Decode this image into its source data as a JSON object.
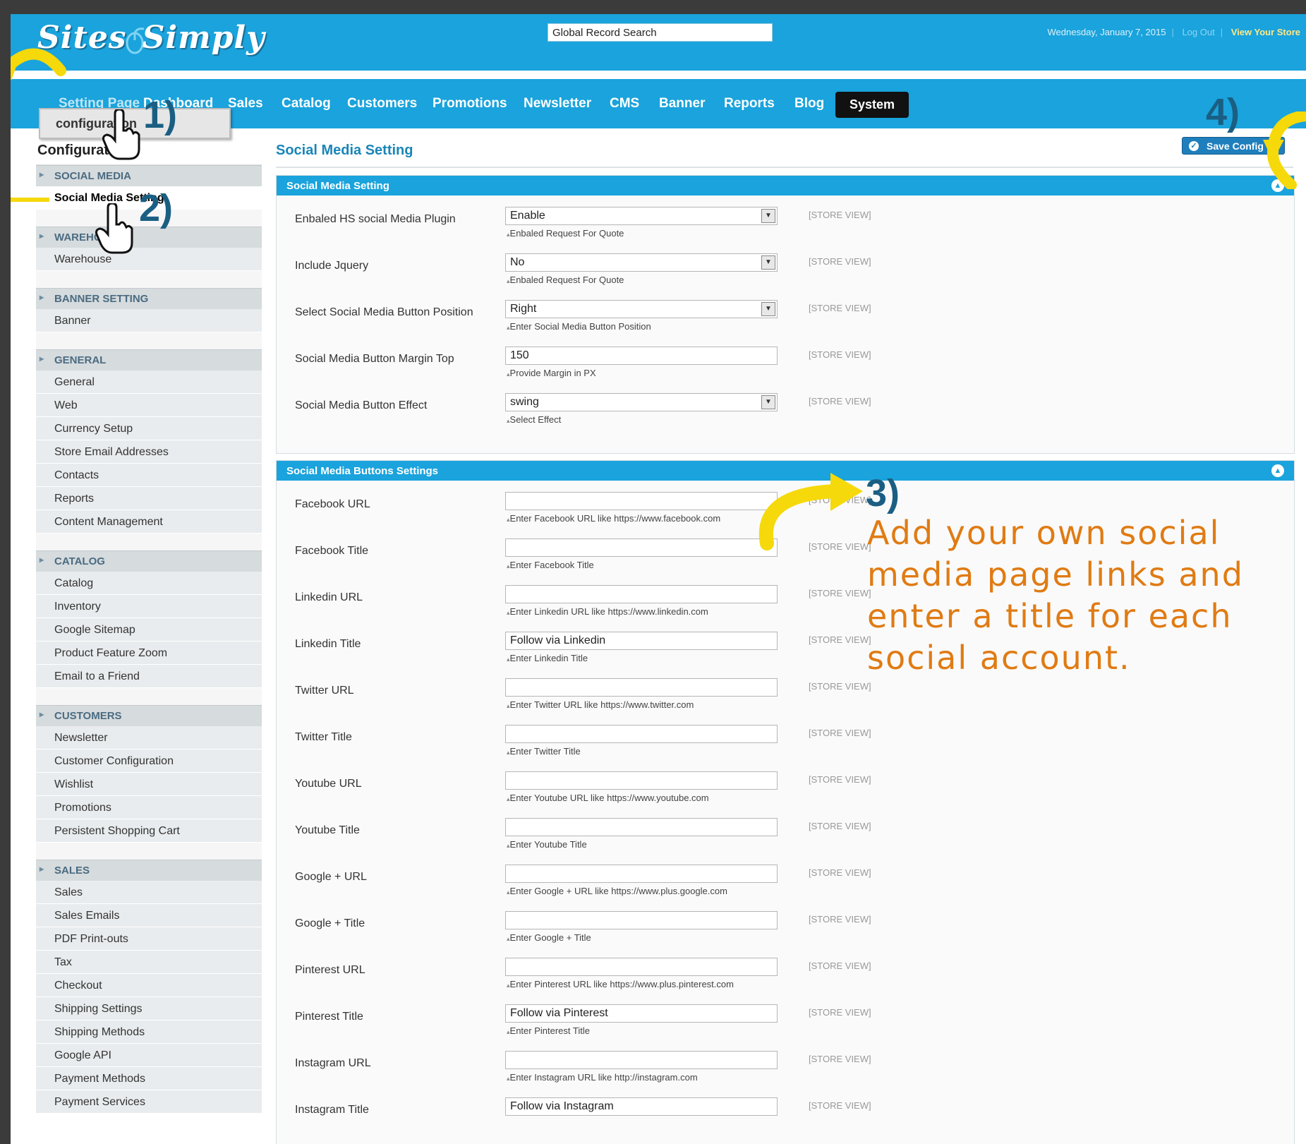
{
  "header": {
    "logo_text": "Sites Simply",
    "search_placeholder": "Global Record Search",
    "date": "Wednesday, January 7, 2015",
    "logout": "Log Out",
    "view_store": "View Your Store"
  },
  "nav": {
    "items": [
      "Setting Page",
      "Dashboard",
      "Sales",
      "Catalog",
      "Customers",
      "Promotions",
      "Newsletter",
      "CMS",
      "Banner",
      "Reports",
      "Blog",
      "System"
    ],
    "active": "System",
    "submenu_item": "configuration"
  },
  "sidebar": {
    "title": "Configuration",
    "groups": [
      {
        "head": "Social Media",
        "items": [
          "Social Media Setting"
        ]
      },
      {
        "head": "Warehouse",
        "items": [
          "Warehouse"
        ]
      },
      {
        "head": "Banner Setting",
        "items": [
          "Banner"
        ]
      },
      {
        "head": "General",
        "items": [
          "General",
          "Web",
          "Currency Setup",
          "Store Email Addresses",
          "Contacts",
          "Reports",
          "Content Management"
        ]
      },
      {
        "head": "Catalog",
        "items": [
          "Catalog",
          "Inventory",
          "Google Sitemap",
          "Product Feature Zoom",
          "Email to a Friend"
        ]
      },
      {
        "head": "Customers",
        "items": [
          "Newsletter",
          "Customer Configuration",
          "Wishlist",
          "Promotions",
          "Persistent Shopping Cart"
        ]
      },
      {
        "head": "Sales",
        "items": [
          "Sales",
          "Sales Emails",
          "PDF Print-outs",
          "Tax",
          "Checkout",
          "Shipping Settings",
          "Shipping Methods",
          "Google API",
          "Payment Methods",
          "Payment Services"
        ]
      }
    ]
  },
  "main": {
    "page_title": "Social Media Setting",
    "save_label": "Save Config",
    "scope_label": "[STORE VIEW]",
    "section1": {
      "title": "Social Media Setting",
      "rows": [
        {
          "label": "Enbaled HS social Media Plugin",
          "value": "Enable",
          "type": "select",
          "note": "Enbaled Request For Quote"
        },
        {
          "label": "Include Jquery",
          "value": "No",
          "type": "select",
          "note": "Enbaled Request For Quote"
        },
        {
          "label": "Select Social Media Button Position",
          "value": "Right",
          "type": "select",
          "note": "Enter Social Media Button Position"
        },
        {
          "label": "Social Media Button Margin Top",
          "value": "150",
          "type": "text",
          "note": "Provide Margin in PX"
        },
        {
          "label": "Social Media Button Effect",
          "value": "swing",
          "type": "select",
          "note": "Select Effect"
        }
      ]
    },
    "section2": {
      "title": "Social Media Buttons Settings",
      "rows": [
        {
          "label": "Facebook URL",
          "value": "",
          "type": "text",
          "note": "Enter Facebook URL like https://www.facebook.com"
        },
        {
          "label": "Facebook Title",
          "value": "",
          "type": "text",
          "note": "Enter Facebook Title"
        },
        {
          "label": "Linkedin URL",
          "value": "",
          "type": "text",
          "note": "Enter Linkedin URL like https://www.linkedin.com"
        },
        {
          "label": "Linkedin Title",
          "value": "Follow via Linkedin",
          "type": "text",
          "note": "Enter Linkedin Title"
        },
        {
          "label": "Twitter URL",
          "value": "",
          "type": "text",
          "note": "Enter Twitter URL like https://www.twitter.com"
        },
        {
          "label": "Twitter Title",
          "value": "",
          "type": "text",
          "note": "Enter Twitter Title"
        },
        {
          "label": "Youtube URL",
          "value": "",
          "type": "text",
          "note": "Enter Youtube URL like https://www.youtube.com"
        },
        {
          "label": "Youtube Title",
          "value": "",
          "type": "text",
          "note": "Enter Youtube Title"
        },
        {
          "label": "Google + URL",
          "value": "",
          "type": "text",
          "note": "Enter Google + URL like https://www.plus.google.com"
        },
        {
          "label": "Google + Title",
          "value": "",
          "type": "text",
          "note": "Enter Google + Title"
        },
        {
          "label": "Pinterest URL",
          "value": "",
          "type": "text",
          "note": "Enter Pinterest URL like https://www.plus.pinterest.com"
        },
        {
          "label": "Pinterest Title",
          "value": "Follow via Pinterest",
          "type": "text",
          "note": "Enter Pinterest Title"
        },
        {
          "label": "Instagram URL",
          "value": "",
          "type": "text",
          "note": "Enter Instagram URL like http://instagram.com"
        },
        {
          "label": "Instagram Title",
          "value": "Follow via Instagram",
          "type": "text",
          "note": ""
        }
      ]
    }
  },
  "annotations": {
    "step1": "1)",
    "step2": "2)",
    "step3": "3)",
    "step4": "4)",
    "step3_text": "Add your own social media page links and enter a title for each social account."
  },
  "colors": {
    "brand": "#1aa3dc",
    "annotation_number": "#1a5f83",
    "annotation_text": "#e07b13",
    "arrow": "#f5d90a"
  }
}
